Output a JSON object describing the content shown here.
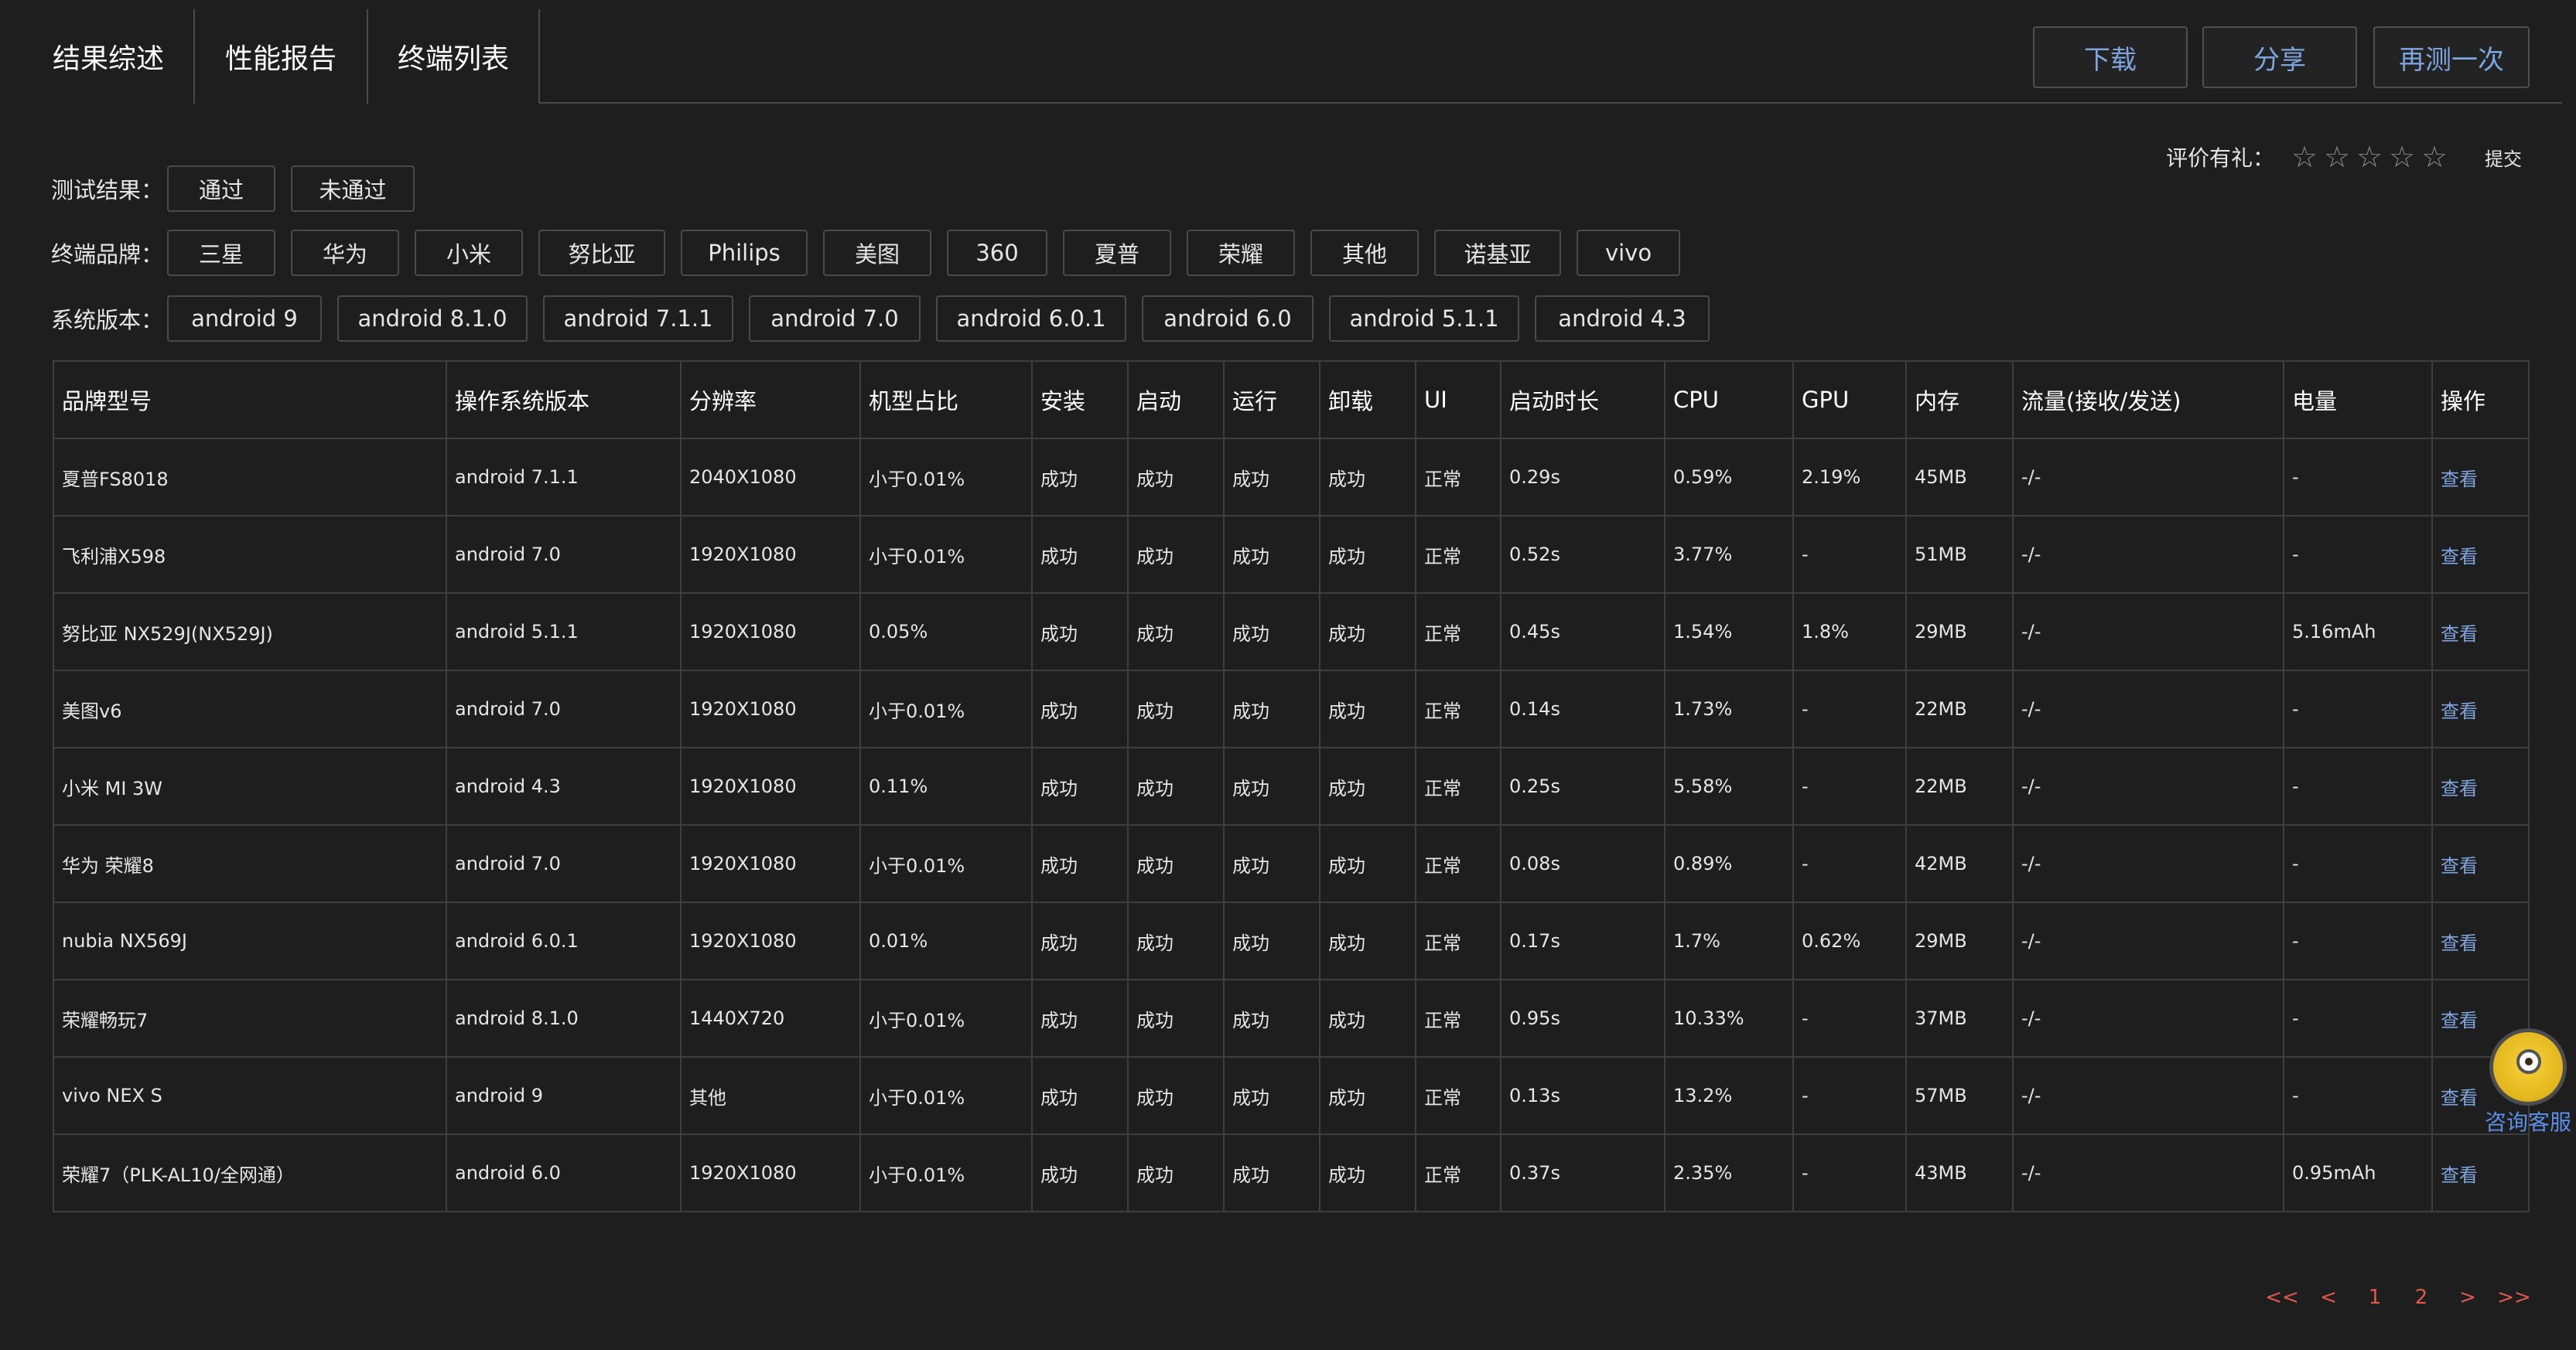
{
  "tabs": [
    "结果综述",
    "性能报告",
    "终端列表"
  ],
  "actions": {
    "download": "下载",
    "share": "分享",
    "retest": "再测一次"
  },
  "rating": {
    "label": "评价有礼：",
    "stars": 5,
    "submit": "提交"
  },
  "filters": {
    "result": {
      "label": "测试结果：",
      "options": [
        "通过",
        "未通过"
      ]
    },
    "brand": {
      "label": "终端品牌：",
      "options": [
        "三星",
        "华为",
        "小米",
        "努比亚",
        "Philips",
        "美图",
        "360",
        "夏普",
        "荣耀",
        "其他",
        "诺基亚",
        "vivo"
      ]
    },
    "os": {
      "label": "系统版本：",
      "options": [
        "android 9",
        "android 8.1.0",
        "android 7.1.1",
        "android 7.0",
        "android 6.0.1",
        "android 6.0",
        "android 5.1.1",
        "android 4.3"
      ]
    }
  },
  "table": {
    "columns": [
      "品牌型号",
      "操作系统版本",
      "分辨率",
      "机型占比",
      "安装",
      "启动",
      "运行",
      "卸载",
      "UI",
      "启动时长",
      "CPU",
      "GPU",
      "内存",
      "流量(接收/发送)",
      "电量",
      "操作"
    ],
    "rows": [
      [
        "夏普FS8018",
        "android 7.1.1",
        "2040X1080",
        "小于0.01%",
        "成功",
        "成功",
        "成功",
        "成功",
        "正常",
        "0.29s",
        "0.59%",
        "2.19%",
        "45MB",
        "-/-",
        "-",
        "查看"
      ],
      [
        "飞利浦X598",
        "android 7.0",
        "1920X1080",
        "小于0.01%",
        "成功",
        "成功",
        "成功",
        "成功",
        "正常",
        "0.52s",
        "3.77%",
        "-",
        "51MB",
        "-/-",
        "-",
        "查看"
      ],
      [
        "努比亚 NX529J(NX529J)",
        "android 5.1.1",
        "1920X1080",
        "0.05%",
        "成功",
        "成功",
        "成功",
        "成功",
        "正常",
        "0.45s",
        "1.54%",
        "1.8%",
        "29MB",
        "-/-",
        "5.16mAh",
        "查看"
      ],
      [
        "美图v6",
        "android 7.0",
        "1920X1080",
        "小于0.01%",
        "成功",
        "成功",
        "成功",
        "成功",
        "正常",
        "0.14s",
        "1.73%",
        "-",
        "22MB",
        "-/-",
        "-",
        "查看"
      ],
      [
        "小米 MI 3W",
        "android 4.3",
        "1920X1080",
        "0.11%",
        "成功",
        "成功",
        "成功",
        "成功",
        "正常",
        "0.25s",
        "5.58%",
        "-",
        "22MB",
        "-/-",
        "-",
        "查看"
      ],
      [
        "华为 荣耀8",
        "android 7.0",
        "1920X1080",
        "小于0.01%",
        "成功",
        "成功",
        "成功",
        "成功",
        "正常",
        "0.08s",
        "0.89%",
        "-",
        "42MB",
        "-/-",
        "-",
        "查看"
      ],
      [
        "nubia NX569J",
        "android 6.0.1",
        "1920X1080",
        "0.01%",
        "成功",
        "成功",
        "成功",
        "成功",
        "正常",
        "0.17s",
        "1.7%",
        "0.62%",
        "29MB",
        "-/-",
        "-",
        "查看"
      ],
      [
        "荣耀畅玩7",
        "android 8.1.0",
        "1440X720",
        "小于0.01%",
        "成功",
        "成功",
        "成功",
        "成功",
        "正常",
        "0.95s",
        "10.33%",
        "-",
        "37MB",
        "-/-",
        "-",
        "查看"
      ],
      [
        "vivo NEX S",
        "android 9",
        "其他",
        "小于0.01%",
        "成功",
        "成功",
        "成功",
        "成功",
        "正常",
        "0.13s",
        "13.2%",
        "-",
        "57MB",
        "-/-",
        "-",
        "查看"
      ],
      [
        "荣耀7（PLK-AL10/全网通）",
        "android 6.0",
        "1920X1080",
        "小于0.01%",
        "成功",
        "成功",
        "成功",
        "成功",
        "正常",
        "0.37s",
        "2.35%",
        "-",
        "43MB",
        "-/-",
        "0.95mAh",
        "查看"
      ]
    ]
  },
  "pagination": [
    "<<",
    "<",
    "1",
    "2",
    ">",
    ">>"
  ],
  "customer_service": {
    "label": "咨询客服",
    "icon": "support-mascot-icon"
  }
}
